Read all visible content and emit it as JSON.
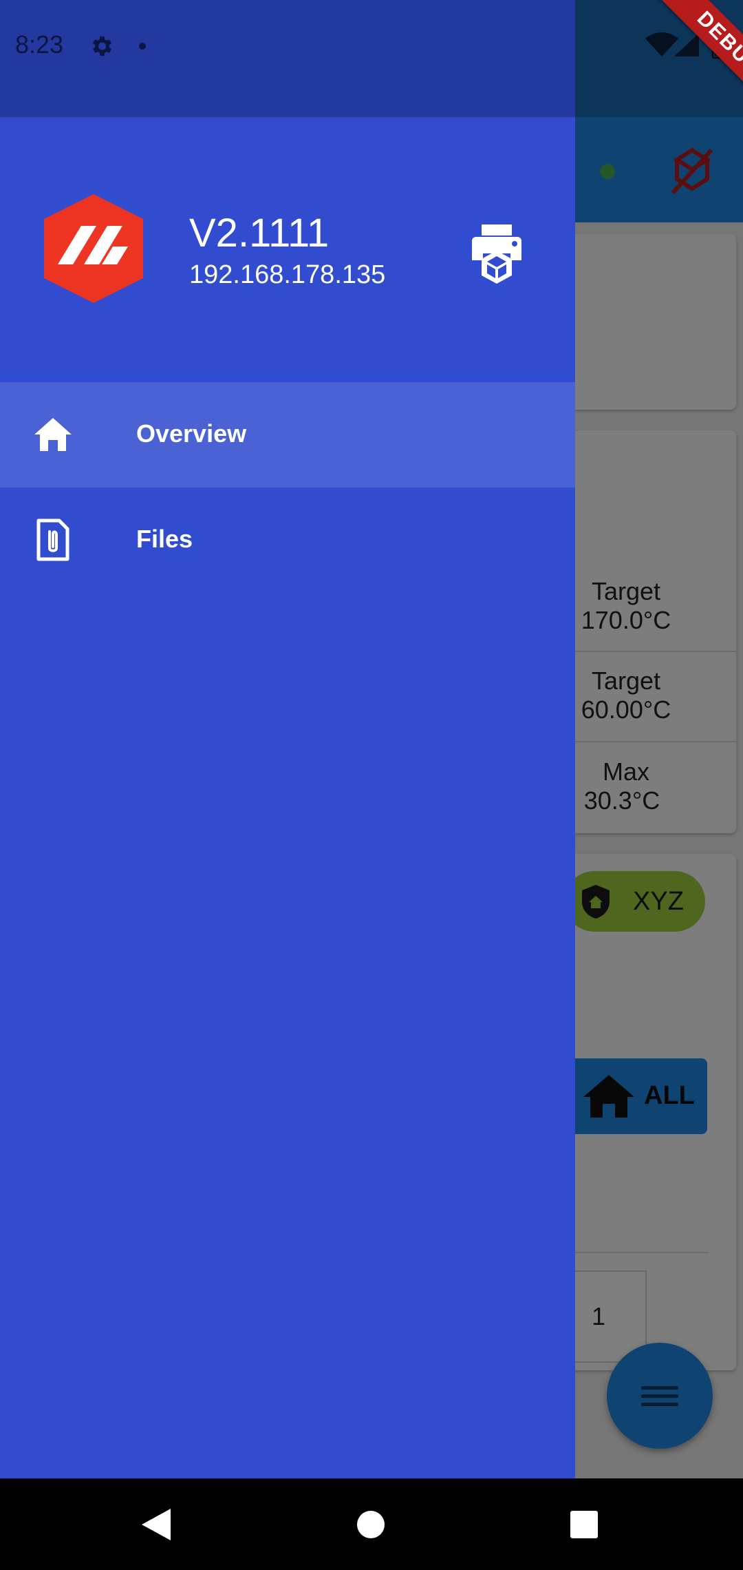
{
  "status_bar": {
    "time": "8:23"
  },
  "debug_banner": "DEBUG",
  "drawer": {
    "printer_name": "V2.1111",
    "printer_ip": "192.168.178.135",
    "nav": [
      {
        "label": "Overview",
        "icon": "home-icon",
        "selected": true
      },
      {
        "label": "Files",
        "icon": "file-attachment-icon",
        "selected": false
      }
    ]
  },
  "background": {
    "temps": [
      {
        "label": "Target",
        "value": "170.0°C"
      },
      {
        "label": "Target",
        "value": "60.00°C"
      },
      {
        "label": "Max",
        "value": "30.3°C"
      }
    ],
    "home_chip": "XYZ",
    "home_all": "ALL",
    "step_value": "1"
  },
  "colors": {
    "drawer": "#314cce",
    "drawer_status": "#2439a0",
    "selected_item": "#4b62d5",
    "logo_red": "#ee3524",
    "app_primary": "#1e88e5"
  }
}
